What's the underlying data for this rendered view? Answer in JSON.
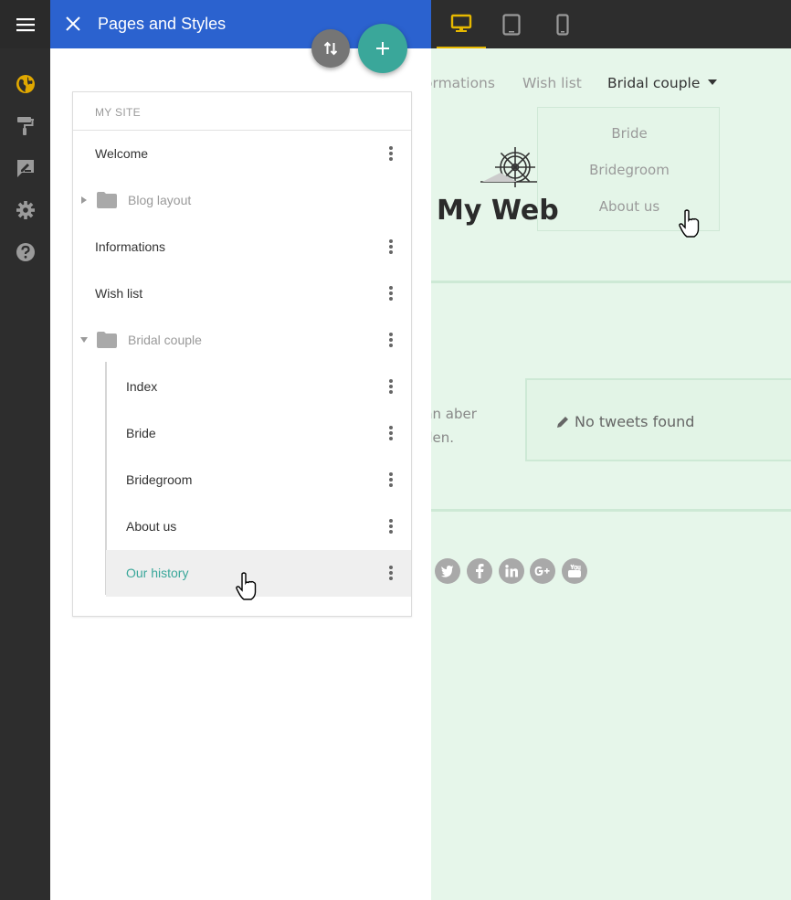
{
  "panel": {
    "title": "Pages and Styles",
    "section_title": "MY SITE",
    "pages": [
      {
        "label": "Welcome",
        "type": "page",
        "level": 0
      },
      {
        "label": "Blog layout",
        "type": "folder",
        "level": 0,
        "expanded": false
      },
      {
        "label": "Informations",
        "type": "page",
        "level": 0
      },
      {
        "label": "Wish list",
        "type": "page",
        "level": 0
      },
      {
        "label": "Bridal couple",
        "type": "folder",
        "level": 0,
        "expanded": true
      },
      {
        "label": "Index",
        "type": "page",
        "level": 1
      },
      {
        "label": "Bride",
        "type": "page",
        "level": 1
      },
      {
        "label": "Bridegroom",
        "type": "page",
        "level": 1
      },
      {
        "label": "About us",
        "type": "page",
        "level": 1
      },
      {
        "label": "Our history",
        "type": "page",
        "level": 1,
        "selected": true
      }
    ]
  },
  "preview": {
    "nav": [
      "ormations",
      "Wish list",
      "Bridal couple"
    ],
    "dropdown": [
      "Bride",
      "Bridegroom",
      "About us"
    ],
    "site_title": "My Web",
    "text_line1": "nn aber",
    "text_line2": "den.",
    "tweets": "No tweets found",
    "social_icons": [
      "twitter-icon",
      "facebook-icon",
      "linkedin-icon",
      "google-plus-icon",
      "youtube-icon"
    ]
  },
  "colors": {
    "header_blue": "#2b62cf",
    "accent_teal": "#3aa79a",
    "active_device": "#e6b800",
    "rail": "#2d2d2d",
    "preview_bg": "#e6f6ea"
  }
}
